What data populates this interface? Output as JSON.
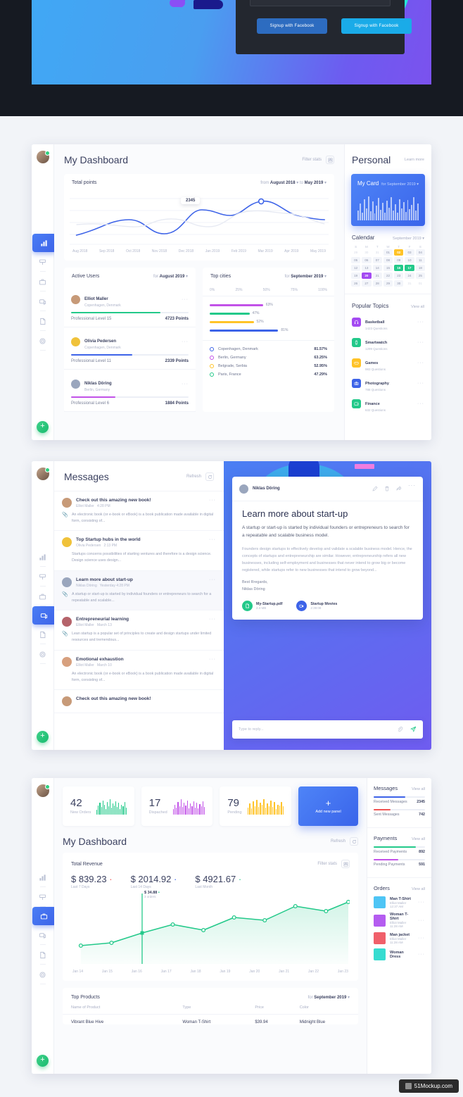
{
  "hero": {
    "signup_facebook_dark": "Signup with Facebook",
    "signup_facebook_light": "Signup with Facebook"
  },
  "window1": {
    "title": "My Dashboard",
    "filter_stats": "Filter stats",
    "total_points": {
      "title": "Total points",
      "from_label": "from",
      "from_value": "August 2018",
      "to_label": "to",
      "to_value": "May 2019",
      "tooltip_value": "2345",
      "x_labels": [
        "Aug 2018",
        "Sep 2018",
        "Oct 2018",
        "Nov 2018",
        "Dec 2018",
        "Jan 2019",
        "Feb 2019",
        "Mar 2019",
        "Apr 2019",
        "May 2019"
      ]
    },
    "active_users": {
      "title": "Active Users",
      "for_label": "for",
      "period": "August 2019",
      "users": [
        {
          "name": "Elliot Maller",
          "location": "Copenhagen, Denmark",
          "level": "Professional Level 15",
          "points": "4723 Points",
          "bar_pct": 76,
          "color": "#23c98a",
          "avatar": "#c79a78"
        },
        {
          "name": "Olivia Pedersen",
          "location": "Copenhagen, Denmark",
          "level": "Professional Level 11",
          "points": "2339 Points",
          "bar_pct": 52,
          "color": "#3d63e8",
          "avatar": "#f0c23a"
        },
        {
          "name": "Niklas Döring",
          "location": "Berlin, Germany",
          "level": "Professional Level 6",
          "points": "1884 Points",
          "bar_pct": 38,
          "color": "#c252e8",
          "avatar": "#9aa6bd"
        }
      ]
    },
    "top_cities": {
      "title": "Top cities",
      "for_label": "for",
      "period": "September 2019",
      "axis": [
        "0%",
        "25%",
        "50%",
        "75%",
        "100%"
      ],
      "bars": [
        {
          "label": "63%",
          "pct": 63,
          "color": "#c252e8"
        },
        {
          "label": "47%",
          "pct": 47,
          "color": "#23c98a"
        },
        {
          "label": "52%",
          "pct": 52,
          "color": "#ffc327"
        },
        {
          "label": "81%",
          "pct": 81,
          "color": "#3d63e8"
        }
      ],
      "legend": [
        {
          "name": "Copenhagen, Denmark",
          "value": "81.57%",
          "color": "#3d63e8"
        },
        {
          "name": "Berlin, Germany",
          "value": "63.25%",
          "color": "#c252e8"
        },
        {
          "name": "Belgrade, Serbia",
          "value": "52.95%",
          "color": "#ffc327"
        },
        {
          "name": "Paris, France",
          "value": "47.29%",
          "color": "#23c98a"
        }
      ]
    },
    "personal": {
      "title": "Personal",
      "learn_more": "Learn more",
      "my_card": {
        "title": "My Card",
        "for_label": "for September 2019"
      },
      "calendar": {
        "title": "Calendar",
        "month": "September 2019",
        "dow": [
          "S",
          "M",
          "T",
          "W",
          "T",
          "F",
          "S"
        ],
        "weeks": [
          [
            {
              "d": "29",
              "s": "out"
            },
            {
              "d": "30",
              "s": "out"
            },
            {
              "d": "31",
              "s": "out"
            },
            {
              "d": "01",
              "s": ""
            },
            {
              "d": "02",
              "s": "y"
            },
            {
              "d": "03",
              "s": ""
            },
            {
              "d": "04",
              "s": ""
            }
          ],
          [
            {
              "d": "05",
              "s": ""
            },
            {
              "d": "06",
              "s": ""
            },
            {
              "d": "07",
              "s": ""
            },
            {
              "d": "08",
              "s": ""
            },
            {
              "d": "09",
              "s": ""
            },
            {
              "d": "10",
              "s": ""
            },
            {
              "d": "11",
              "s": ""
            }
          ],
          [
            {
              "d": "12",
              "s": ""
            },
            {
              "d": "13",
              "s": ""
            },
            {
              "d": "14",
              "s": ""
            },
            {
              "d": "15",
              "s": ""
            },
            {
              "d": "16",
              "s": "g"
            },
            {
              "d": "17",
              "s": "g"
            },
            {
              "d": "18",
              "s": ""
            }
          ],
          [
            {
              "d": "19",
              "s": ""
            },
            {
              "d": "20",
              "s": "p"
            },
            {
              "d": "21",
              "s": ""
            },
            {
              "d": "22",
              "s": ""
            },
            {
              "d": "23",
              "s": ""
            },
            {
              "d": "24",
              "s": ""
            },
            {
              "d": "25",
              "s": ""
            }
          ],
          [
            {
              "d": "26",
              "s": ""
            },
            {
              "d": "27",
              "s": ""
            },
            {
              "d": "28",
              "s": ""
            },
            {
              "d": "29",
              "s": ""
            },
            {
              "d": "30",
              "s": ""
            },
            {
              "d": "31",
              "s": "out"
            },
            {
              "d": "01",
              "s": "out"
            }
          ]
        ]
      },
      "popular_topics": {
        "title": "Popular Topics",
        "view_all": "View all",
        "items": [
          {
            "name": "Basketball",
            "questions": "1423 Questions",
            "color": "#a44bf2",
            "icon": "headphones-icon"
          },
          {
            "name": "Smartwatch",
            "questions": "1299 Questions",
            "color": "#23c98a",
            "icon": "watch-icon"
          },
          {
            "name": "Games",
            "questions": "983 Questions",
            "color": "#ffc327",
            "icon": "gamepad-icon"
          },
          {
            "name": "Photography",
            "questions": "788 Questions",
            "color": "#3d63e8",
            "icon": "camera-icon"
          },
          {
            "name": "Finance",
            "questions": "632 Questions",
            "color": "#23c98a",
            "icon": "wallet-icon"
          }
        ]
      }
    }
  },
  "window2": {
    "title": "Messages",
    "refresh": "Refresh",
    "messages": [
      {
        "title": "Check out this amazing new book!",
        "author": "Elliot Maller",
        "time": "4:28 PM",
        "preview": "An electronic book (or e-book or eBook) is a book publication made available in digital form, consisting of...",
        "avatar": "#c79a78",
        "has_clip": true,
        "selected": false
      },
      {
        "title": "Top Startup hubs in the world",
        "author": "Olivia Pedersen",
        "time": "2:13 PM",
        "preview": "Startups concerns possibilities of starting ventures and therefore is a design science. Design science uses design...",
        "avatar": "#f0c23a",
        "has_clip": false,
        "selected": false
      },
      {
        "title": "Learn more about start-up",
        "author": "Niklas Döring",
        "time": "Yesterday 4:28 PM",
        "preview": "A startup or start-up is started by individual founders or entrepreneurs to search for a repeatable and scalable...",
        "avatar": "#9aa6bd",
        "has_clip": true,
        "selected": true
      },
      {
        "title": "Entrepreneurial learning",
        "author": "Elliot Maller",
        "time": "March 13",
        "preview": "Lean startup is a popular set of principles to create and design startups under limited resources and tremendous...",
        "avatar": "#b5636a",
        "has_clip": true,
        "selected": false
      },
      {
        "title": "Emotional exhaustion",
        "author": "Elliot Maller",
        "time": "March 10",
        "preview": "An electronic book (or e-book or eBook) is a book publication made available in digital form, consisting of...",
        "avatar": "#d7a07e",
        "has_clip": false,
        "selected": false
      },
      {
        "title": "Check out this amazing new book!",
        "author": "",
        "time": "",
        "preview": "",
        "avatar": "#c79a78",
        "has_clip": false,
        "selected": false
      }
    ],
    "detail": {
      "sender": "Niklas Döring",
      "heading": "Learn more about start-up",
      "lead": "A startup or start-up is started by individual founders or entrepreneurs to search for a repeatable and scalable business model.",
      "body": "Founders design startups to effectively develop and validate a scalable business model. Hence, the concepts of startups and entrepreneurship are similar. However, entrepreneurship refers all new businesses, including self-employment and businesses that never intend to grow big or become registered, while startups refer to new businesses that intend to grow beyond...",
      "signoff_line1": "Best Rregards,",
      "signoff_line2": "Niklas Döring",
      "attachments": [
        {
          "name": "My-Startup.pdf",
          "size": "2.4 MB",
          "color": "#23c98a",
          "icon": "file-icon"
        },
        {
          "name": "Startup Movies",
          "size": "2:39:08",
          "color": "#3d63e8",
          "icon": "video-icon"
        }
      ],
      "reply_placeholder": "Type to reply..."
    }
  },
  "window3": {
    "title": "My Dashboard",
    "refresh": "Refresh",
    "filter_stats": "Filter stats",
    "stats": [
      {
        "value": "42",
        "label": "New Orders",
        "color": "#23c98a"
      },
      {
        "value": "17",
        "label": "Dispached",
        "color": "#c252e8"
      },
      {
        "value": "79",
        "label": "Pending",
        "color": "#ffc327"
      }
    ],
    "add_panel": "Add new panel",
    "revenue": {
      "title": "Total Revenue",
      "figures": [
        {
          "value": "$ 839.23",
          "label": "Last 7 Days",
          "dot": "#f05454"
        },
        {
          "value": "$ 2014.92",
          "label": "Last 14 Days",
          "dot": "#3d63e8"
        },
        {
          "value": "$ 4921.67",
          "label": "Last Month",
          "dot": "#23c98a"
        }
      ],
      "tooltip_value": "$ 34.88",
      "tooltip_sub": "3 orders",
      "x_labels": [
        "Jan 14",
        "Jan 15",
        "Jan 16",
        "Jan 17",
        "Jan 18",
        "Jan 19",
        "Jan 20",
        "Jan 21",
        "Jan 22",
        "Jan 23"
      ]
    },
    "top_products": {
      "title": "Top Products",
      "for_label": "for",
      "period": "September 2019",
      "columns": [
        "Name of Product",
        "Type",
        "Price",
        "Color"
      ],
      "rows": [
        [
          "Vibrant Blue Hive",
          "Woman T-Shirt",
          "$39.94",
          "Midnight Blue"
        ]
      ]
    },
    "sidebar": {
      "messages": {
        "title": "Messages",
        "view_all": "View all",
        "rows": [
          {
            "label": "Received Messages",
            "value": "2345",
            "pct": 62,
            "color": "#3d63e8"
          },
          {
            "label": "Sent Messages",
            "value": "742",
            "pct": 33,
            "color": "#f05454"
          }
        ]
      },
      "payments": {
        "title": "Payments",
        "view_all": "View all",
        "rows": [
          {
            "label": "Received Payments",
            "value": "892",
            "pct": 82,
            "color": "#23c98a"
          },
          {
            "label": "Pending Payments",
            "value": "591",
            "pct": 48,
            "color": "#c252e8"
          }
        ]
      },
      "orders": {
        "title": "Orders",
        "view_all": "View all",
        "items": [
          {
            "name": "Man T-Shirt",
            "meta": "Elliot Maller   12:37 AM",
            "color": "#4ec5f5"
          },
          {
            "name": "Woman T-Shirt",
            "meta": "Elliot Maller   11:28 AM",
            "color": "#b45cf0"
          },
          {
            "name": "Man jacket",
            "meta": "Elliot Maller   11:28 AM",
            "color": "#f0606a"
          },
          {
            "name": "Woman Dress",
            "meta": "",
            "color": "#36dcd0"
          }
        ]
      }
    }
  },
  "watermark": "51Mockup.com",
  "chart_data": [
    {
      "type": "line",
      "title": "Total points",
      "x": [
        "Aug 2018",
        "Sep 2018",
        "Oct 2018",
        "Nov 2018",
        "Dec 2018",
        "Jan 2019",
        "Feb 2019",
        "Mar 2019",
        "Apr 2019",
        "May 2019"
      ],
      "series": [
        {
          "name": "Points",
          "values": [
            18,
            42,
            45,
            22,
            55,
            74,
            58,
            66,
            78,
            52
          ],
          "color": "#3d63e8"
        },
        {
          "name": "Comparison",
          "values": [
            40,
            44,
            46,
            40,
            52,
            48,
            56,
            62,
            62,
            50
          ],
          "color": "#e6e9f2"
        }
      ],
      "annotation": {
        "label": "2345",
        "at": "Jan 2019"
      },
      "ylim": [
        0,
        100
      ],
      "grid": true,
      "legend": "none"
    },
    {
      "type": "bar",
      "title": "Top cities",
      "orientation": "horizontal",
      "categories": [
        "Berlin, Germany",
        "Paris, France",
        "Belgrade, Serbia",
        "Copenhagen, Denmark"
      ],
      "values": [
        63,
        47,
        52,
        81
      ],
      "value_labels": [
        "63%",
        "47%",
        "52%",
        "81%"
      ],
      "colors": [
        "#c252e8",
        "#23c98a",
        "#ffc327",
        "#3d63e8"
      ],
      "xlim": [
        0,
        100
      ],
      "xticks": [
        "0%",
        "25%",
        "50%",
        "75%",
        "100%"
      ]
    },
    {
      "type": "area",
      "title": "Total Revenue",
      "x": [
        "Jan 14",
        "Jan 15",
        "Jan 16",
        "Jan 17",
        "Jan 18",
        "Jan 19",
        "Jan 20",
        "Jan 21",
        "Jan 22",
        "Jan 23"
      ],
      "series": [
        {
          "name": "Revenue",
          "values": [
            22,
            27,
            38,
            48,
            40,
            58,
            54,
            72,
            65,
            78
          ],
          "color": "#23c98a"
        }
      ],
      "annotation": {
        "label": "$ 34.88",
        "sub": "3 orders",
        "at": "Jan 16"
      },
      "ylim": [
        0,
        100
      ],
      "grid": false
    },
    {
      "type": "bar",
      "title": "My Card",
      "categories": [],
      "values": [
        38,
        62,
        30,
        78,
        44,
        90,
        34,
        70,
        26,
        56,
        84,
        40,
        66,
        30,
        74,
        48,
        88,
        36,
        60,
        28,
        80,
        46,
        68,
        32,
        76,
        42,
        58,
        86,
        38,
        64
      ],
      "colors": [
        "rgba(255,255,255,0.62)"
      ]
    },
    {
      "type": "bar",
      "title": "New Orders",
      "values": [
        30,
        55,
        70,
        45,
        85,
        60,
        35,
        75,
        50,
        90,
        40,
        65,
        55,
        80,
        45,
        70,
        35,
        60,
        50,
        75,
        40
      ],
      "colors": [
        "#23c98a"
      ]
    },
    {
      "type": "bar",
      "title": "Dispached",
      "values": [
        35,
        60,
        40,
        75,
        50,
        90,
        45,
        70,
        55,
        85,
        38,
        65,
        48,
        80,
        42,
        72,
        36,
        62,
        52,
        78,
        44
      ],
      "colors": [
        "#c252e8"
      ]
    },
    {
      "type": "bar",
      "title": "Pending",
      "values": [
        42,
        68,
        38,
        80,
        52,
        88,
        44,
        72,
        58,
        92,
        40,
        66,
        50,
        84,
        46,
        74,
        34,
        60,
        54,
        76,
        48
      ],
      "colors": [
        "#ffc327"
      ]
    }
  ]
}
